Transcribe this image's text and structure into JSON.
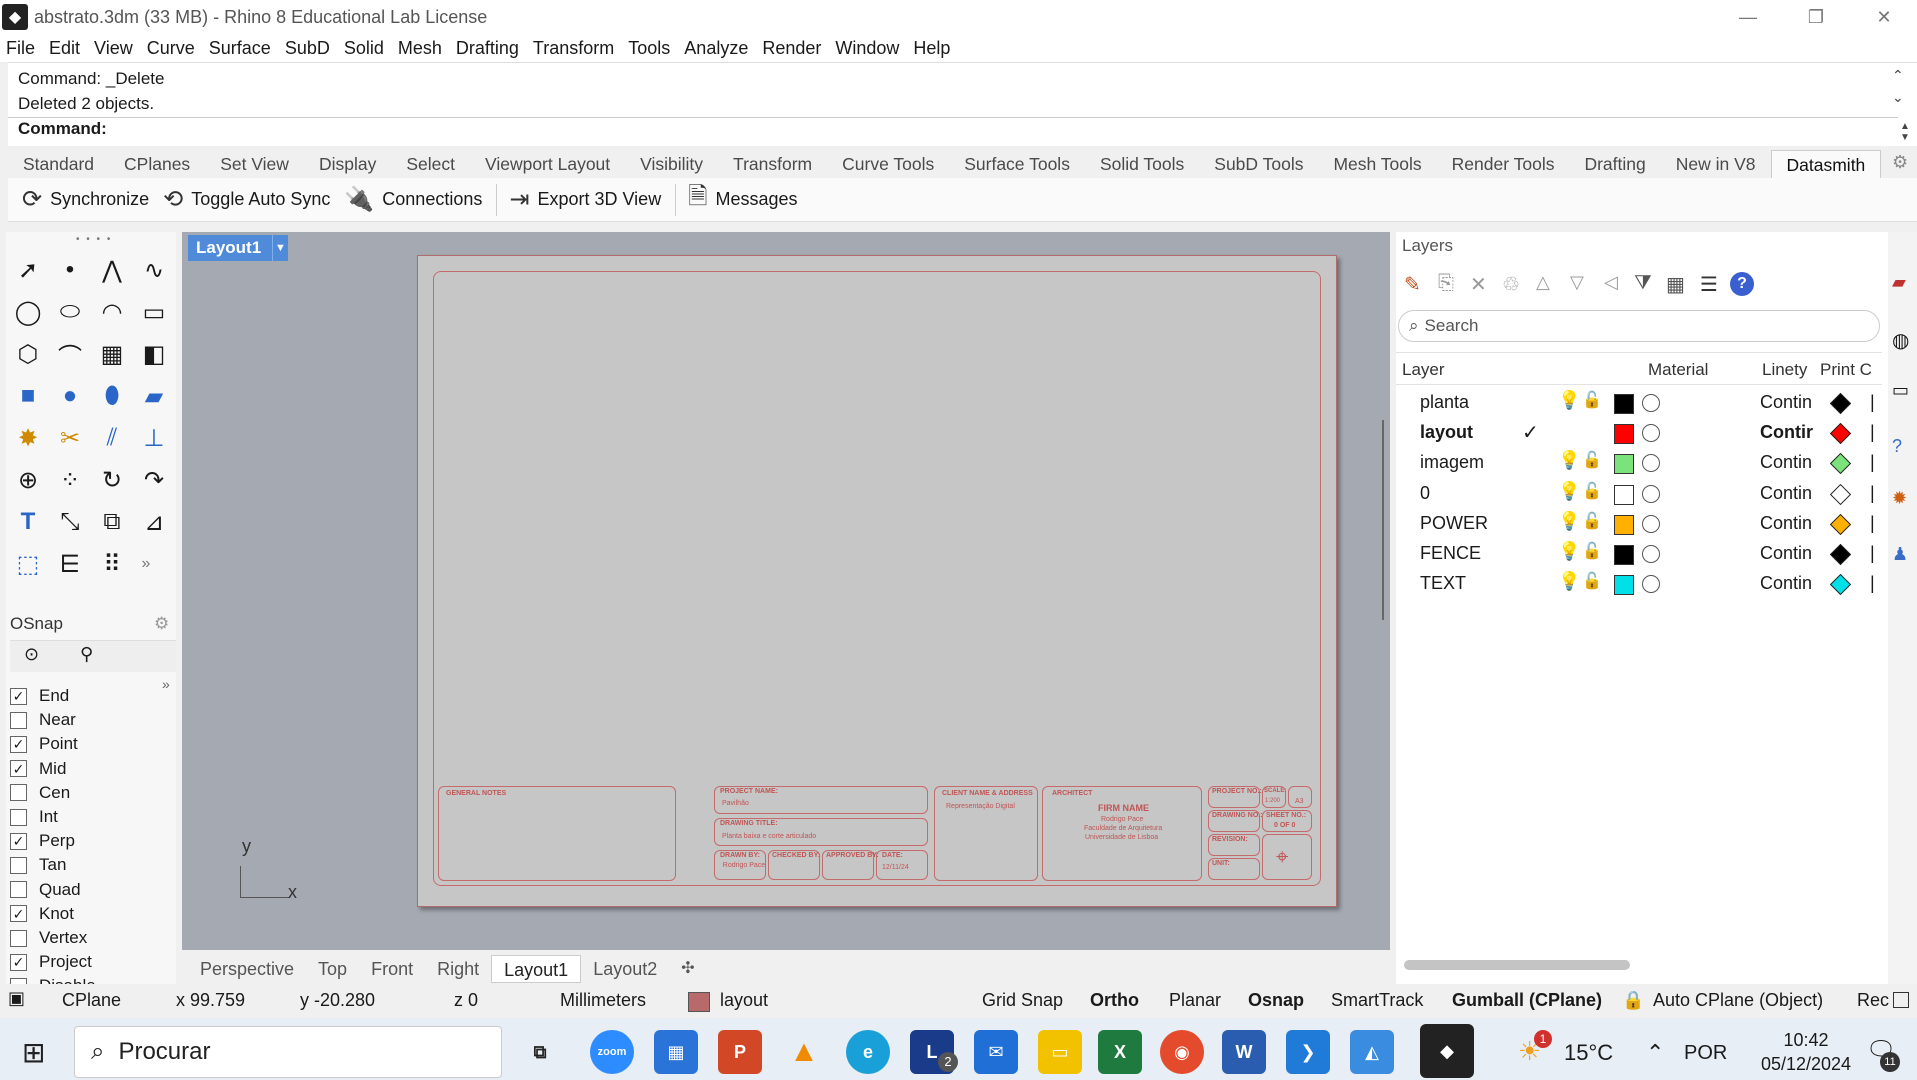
{
  "window": {
    "title": "abstrato.3dm (33 MB) - Rhino 8 Educational Lab License"
  },
  "menu": [
    "File",
    "Edit",
    "View",
    "Curve",
    "Surface",
    "SubD",
    "Solid",
    "Mesh",
    "Drafting",
    "Transform",
    "Tools",
    "Analyze",
    "Render",
    "Window",
    "Help"
  ],
  "command": {
    "history": [
      "Command: _Delete",
      "Deleted 2 objects."
    ],
    "prompt": "Command:"
  },
  "tabs": [
    "Standard",
    "CPlanes",
    "Set View",
    "Display",
    "Select",
    "Viewport Layout",
    "Visibility",
    "Transform",
    "Curve Tools",
    "Surface Tools",
    "Solid Tools",
    "SubD Tools",
    "Mesh Tools",
    "Render Tools",
    "Drafting",
    "New in V8",
    "Datasmith"
  ],
  "toolbar": {
    "synchronize": "Synchronize",
    "toggle_auto_sync": "Toggle Auto Sync",
    "connections": "Connections",
    "export_3d_view": "Export 3D View",
    "messages": "Messages"
  },
  "osnap": {
    "title": "OSnap",
    "items": [
      {
        "label": "End",
        "checked": true
      },
      {
        "label": "Near",
        "checked": false
      },
      {
        "label": "Point",
        "checked": true
      },
      {
        "label": "Mid",
        "checked": true
      },
      {
        "label": "Cen",
        "checked": false
      },
      {
        "label": "Int",
        "checked": false
      },
      {
        "label": "Perp",
        "checked": true
      },
      {
        "label": "Tan",
        "checked": false
      },
      {
        "label": "Quad",
        "checked": false
      },
      {
        "label": "Knot",
        "checked": true
      },
      {
        "label": "Vertex",
        "checked": false
      },
      {
        "label": "Project",
        "checked": true
      },
      {
        "label": "Disable",
        "checked": false
      }
    ]
  },
  "viewport": {
    "active_tab": "Layout1",
    "axis_y": "y",
    "axis_x": "x",
    "titleblock": {
      "general_notes": "GENERAL NOTES",
      "project_name": "PROJECT NAME:",
      "project_value": "Pavilhão",
      "drawing_title": "DRAWING TITLE:",
      "drawing_value": "Planta baixa e corte articulado",
      "drawn_by": "DRAWN BY:",
      "drawn_value": "Rodrigo Pace",
      "checked_by": "CHECKED BY:",
      "approved_by": "APPROVED BY:",
      "date": "DATE:",
      "date_value": "12/11/24",
      "client": "CLIENT NAME & ADDRESS",
      "client_value": "Representação Digital",
      "architect": "ARCHITECT",
      "firm_name": "FIRM NAME",
      "firm_lines": [
        "Rodrigo Pace",
        "Faculdade de Arquitetura",
        "Universidade de Lisboa"
      ],
      "project_no": "PROJECT NO.:",
      "scale": "SCALE:",
      "drawing_no": "DRAWING NO.:",
      "sheet_no": "SHEET NO.:",
      "sheet_value": "0 OF 0",
      "revision": "REVISION:",
      "unit": "UNIT:",
      "scale_value": "1:200",
      "paper": "A3"
    }
  },
  "view_tabs": [
    "Perspective",
    "Top",
    "Front",
    "Right",
    "Layout1",
    "Layout2"
  ],
  "layers": {
    "title": "Layers",
    "search_placeholder": "Search",
    "columns": {
      "layer": "Layer",
      "material": "Material",
      "linetype": "Linety",
      "print": "Print C"
    },
    "rows": [
      {
        "name": "planta",
        "current": false,
        "bulb_on": true,
        "color": "#000000",
        "linetype": "Contin",
        "print": "#000000"
      },
      {
        "name": "layout",
        "current": true,
        "bulb_on": true,
        "color": "#ff0000",
        "linetype": "Contir",
        "print": "#ff0000"
      },
      {
        "name": "imagem",
        "current": false,
        "bulb_on": false,
        "color": "#7be37b",
        "linetype": "Contin",
        "print": "#7be37b"
      },
      {
        "name": "0",
        "current": false,
        "bulb_on": true,
        "color": "#ffffff",
        "linetype": "Contin",
        "print": "#ffffff"
      },
      {
        "name": "POWER",
        "current": false,
        "bulb_on": true,
        "color": "#ffb000",
        "linetype": "Contin",
        "print": "#ffb000"
      },
      {
        "name": "FENCE",
        "current": false,
        "bulb_on": true,
        "color": "#000000",
        "linetype": "Contin",
        "print": "#000000"
      },
      {
        "name": "TEXT",
        "current": false,
        "bulb_on": true,
        "color": "#00e0e8",
        "linetype": "Contin",
        "print": "#00e0e8"
      }
    ]
  },
  "status": {
    "cplane": "CPlane",
    "x": "x 99.759",
    "y": "y -20.280",
    "z": "z 0",
    "units": "Millimeters",
    "layer": "layout",
    "grid_snap": "Grid Snap",
    "ortho": "Ortho",
    "planar": "Planar",
    "osnap": "Osnap",
    "smarttrack": "SmartTrack",
    "gumball": "Gumball (CPlane)",
    "auto_cplane": "Auto CPlane (Object)",
    "rec": "Rec"
  },
  "taskbar": {
    "search": "Procurar",
    "temp": "15°C",
    "lang": "POR",
    "time": "10:42",
    "date": "05/12/2024",
    "notif": "11",
    "weather_badge": "1",
    "l_badge": "2"
  }
}
